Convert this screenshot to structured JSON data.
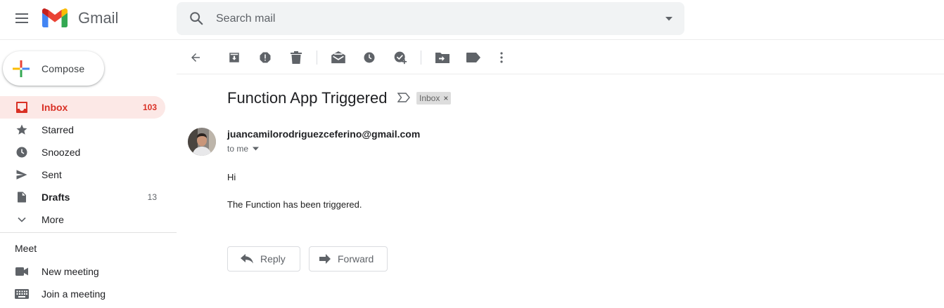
{
  "app": {
    "name": "Gmail"
  },
  "search": {
    "placeholder": "Search mail"
  },
  "compose": {
    "label": "Compose"
  },
  "sidebar": {
    "items": [
      {
        "label": "Inbox",
        "count": "103",
        "icon": "inbox-icon",
        "active": true
      },
      {
        "label": "Starred",
        "count": "",
        "icon": "star-icon"
      },
      {
        "label": "Snoozed",
        "count": "",
        "icon": "clock-icon"
      },
      {
        "label": "Sent",
        "count": "",
        "icon": "send-icon"
      },
      {
        "label": "Drafts",
        "count": "13",
        "icon": "draft-icon"
      },
      {
        "label": "More",
        "count": "",
        "icon": "chevron-down-icon"
      }
    ]
  },
  "meet": {
    "title": "Meet",
    "items": [
      {
        "label": "New meeting",
        "icon": "video-camera-icon"
      },
      {
        "label": "Join a meeting",
        "icon": "keyboard-icon"
      }
    ]
  },
  "toolbar": {
    "buttons": [
      "back-arrow-icon",
      "archive-icon",
      "report-spam-icon",
      "delete-icon",
      "mark-unread-icon",
      "snooze-icon",
      "add-to-tasks-icon",
      "move-to-icon",
      "label-icon",
      "more-vert-icon"
    ]
  },
  "message": {
    "subject": "Function App Triggered",
    "label": "Inbox",
    "label_remove": "×",
    "sender": "juancamilorodriguezceferino@gmail.com",
    "recipient": "to me",
    "body": [
      "Hi",
      "The Function has been triggered."
    ]
  },
  "actions": {
    "reply_label": "Reply",
    "forward_label": "Forward"
  },
  "colors": {
    "accent": "#d93025",
    "active_bg": "#fce8e6",
    "search_bg": "#f1f3f4",
    "icon": "#5f6368"
  }
}
